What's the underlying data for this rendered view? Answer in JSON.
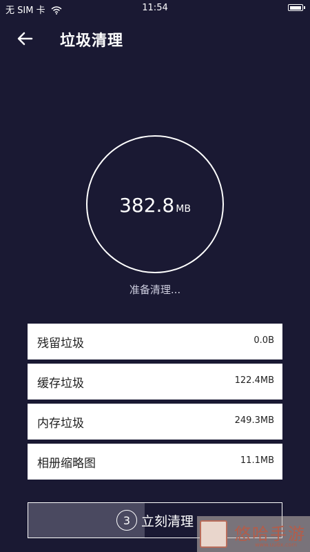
{
  "status_bar": {
    "carrier": "无 SIM 卡",
    "time": "11:54"
  },
  "header": {
    "title": "垃圾清理"
  },
  "summary": {
    "size_value": "382.8",
    "size_unit": "MB",
    "status": "准备清理..."
  },
  "items": [
    {
      "label": "残留垃圾",
      "value": "0.0B"
    },
    {
      "label": "缓存垃圾",
      "value": "122.4MB"
    },
    {
      "label": "内存垃圾",
      "value": "249.3MB"
    },
    {
      "label": "相册缩略图",
      "value": "11.1MB"
    }
  ],
  "clean_button": {
    "countdown": "3",
    "label": "立刻清理",
    "progress_fraction": 0.46
  },
  "watermark": {
    "text": "悠哈手游",
    "url": "www.uu6x.com"
  },
  "colors": {
    "background": "#1a1933",
    "progress_fill": "#4a4960"
  }
}
